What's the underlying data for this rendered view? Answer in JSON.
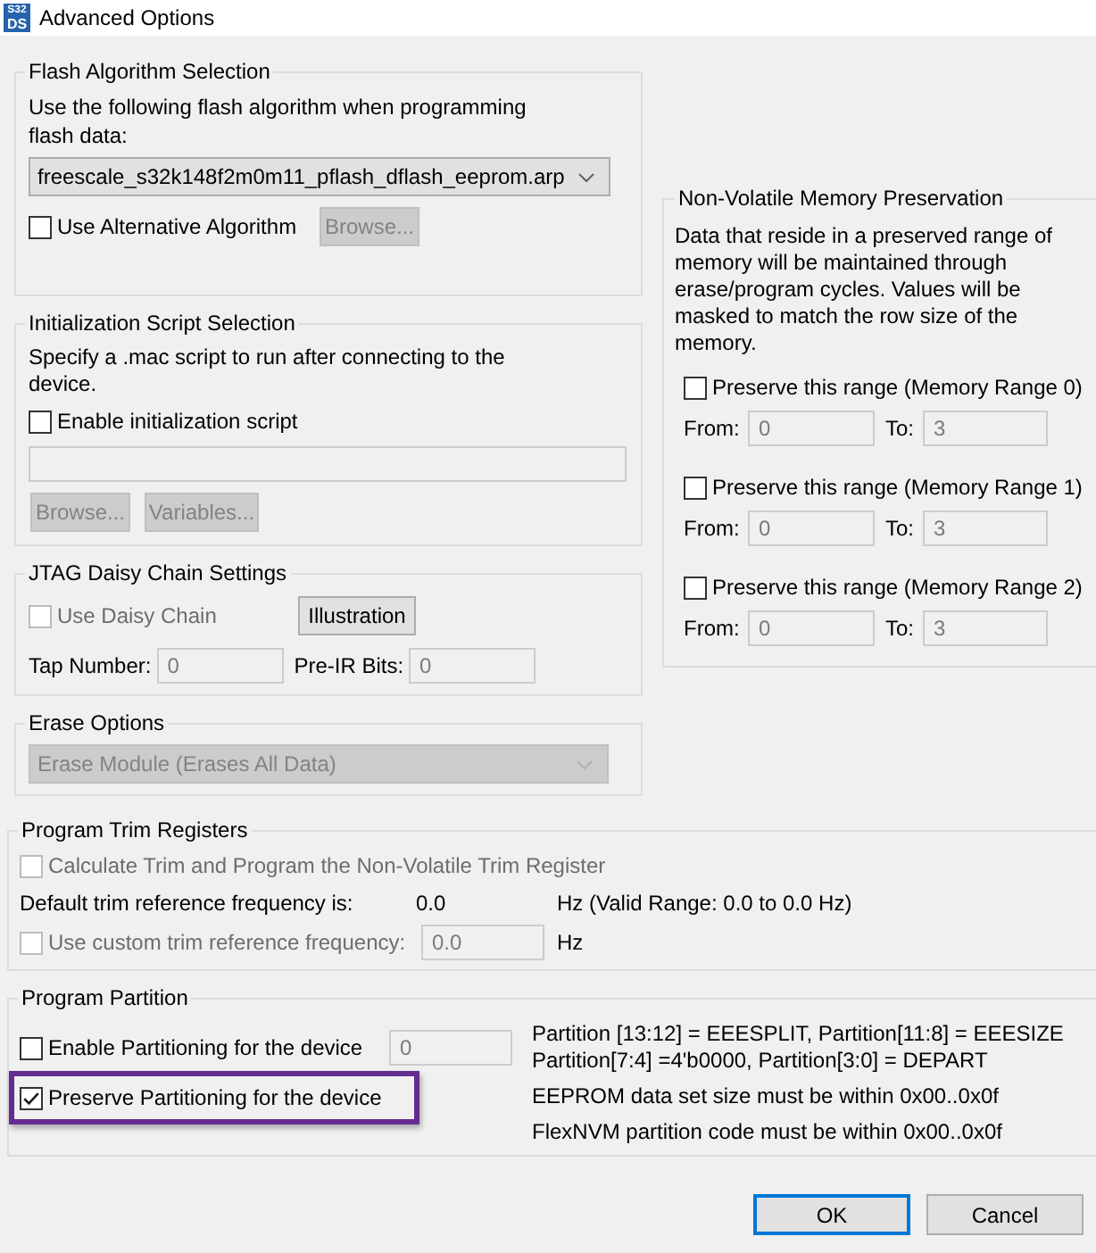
{
  "window": {
    "title": "Advanced Options",
    "logo": [
      "S32",
      "DS"
    ]
  },
  "flash_algorithm": {
    "title": "Flash Algorithm Selection",
    "description": "Use the following flash algorithm when programming flash data:",
    "algorithm": {
      "value": "freescale_s32k148f2m0m11_pflash_dflash_eeprom.arp",
      "disabled": false
    },
    "alternative": {
      "label": "Use Alternative Algorithm",
      "checked": false,
      "disabled": false
    },
    "browse": {
      "label": "Browse...",
      "disabled": true
    }
  },
  "init_script": {
    "title": "Initialization Script Selection",
    "description": "Specify a .mac script to run after connecting to the device.",
    "enable": {
      "label": "Enable initialization script",
      "checked": false,
      "disabled": false
    },
    "path": {
      "disabled": true
    },
    "buttons": [
      {
        "label": "Browse...",
        "disabled": true
      },
      {
        "label": "Variables...",
        "disabled": true
      }
    ]
  },
  "jtag": {
    "title": "JTAG Daisy Chain Settings",
    "daisy_chain": {
      "label": "Use Daisy Chain",
      "checked": false,
      "disabled": true
    },
    "illustration": {
      "label": "Illustration",
      "disabled": false
    },
    "fields": [
      {
        "label": "Tap Number:",
        "value": "0",
        "disabled": true
      },
      {
        "label": "Pre-IR Bits:",
        "value": "0",
        "disabled": true
      }
    ]
  },
  "erase": {
    "title": "Erase Options",
    "mode": {
      "value": "Erase Module (Erases All Data)",
      "disabled": true
    }
  },
  "memory_preservation": {
    "title": "Non-Volatile Memory Preservation",
    "description": "Data that reside in a preserved range of memory will be maintained through erase/program cycles. Values will be masked to match the row size of the memory.",
    "ranges": [
      {
        "checkbox": {
          "label": "Preserve this range (Memory Range 0)",
          "checked": false,
          "disabled": false
        },
        "from": {
          "label": "From:",
          "value": "0",
          "disabled": true
        },
        "to": {
          "label": "To:",
          "value": "3",
          "disabled": true
        }
      },
      {
        "checkbox": {
          "label": "Preserve this range (Memory Range 1)",
          "checked": false,
          "disabled": false
        },
        "from": {
          "label": "From:",
          "value": "0",
          "disabled": true
        },
        "to": {
          "label": "To:",
          "value": "3",
          "disabled": true
        }
      },
      {
        "checkbox": {
          "label": "Preserve this range (Memory Range 2)",
          "checked": false,
          "disabled": false
        },
        "from": {
          "label": "From:",
          "value": "0",
          "disabled": true
        },
        "to": {
          "label": "To:",
          "value": "3",
          "disabled": true
        }
      }
    ]
  },
  "trim": {
    "title": "Program Trim Registers",
    "calculate": {
      "label": "Calculate Trim and Program the Non-Volatile Trim Register",
      "checked": false,
      "disabled": true
    },
    "default": {
      "label": "Default trim reference frequency is:",
      "value": "0.0",
      "range": "Hz (Valid Range: 0.0 to 0.0 Hz)"
    },
    "custom": {
      "checkbox": {
        "label": "Use custom trim reference frequency:",
        "checked": false,
        "disabled": true
      },
      "field": {
        "value": "0.0",
        "disabled": true
      },
      "unit": "Hz"
    }
  },
  "partition": {
    "title": "Program Partition",
    "options": [
      {
        "label": "Enable Partitioning for the device",
        "checked": false,
        "disabled": false,
        "highlighted": false,
        "field": {
          "value": "0",
          "disabled": true
        }
      },
      {
        "label": "Preserve Partitioning for the device",
        "checked": true,
        "disabled": false,
        "highlighted": true
      }
    ],
    "notes": [
      "Partition [13:12] = EEESPLIT, Partition[11:8] = EEESIZE",
      "Partition[7:4] =4'b0000, Partition[3:0] = DEPART",
      "EEPROM data set size must be within 0x00..0x0f",
      "FlexNVM partition code must be within 0x00..0x0f"
    ]
  },
  "buttons": [
    {
      "label": "OK",
      "default": true
    },
    {
      "label": "Cancel",
      "default": false
    }
  ]
}
